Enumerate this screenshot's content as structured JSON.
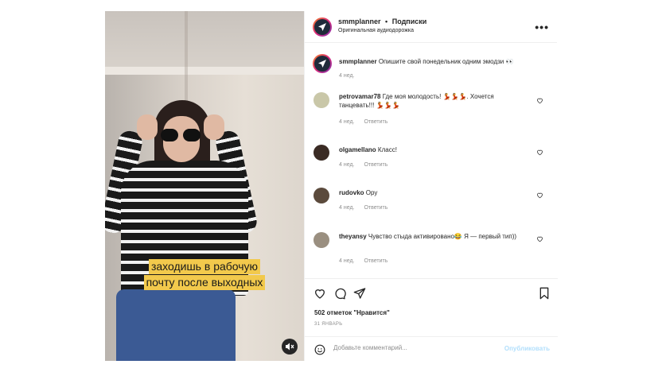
{
  "video": {
    "caption_line1": "заходишь в рабочую",
    "caption_line2": "почту после выходных",
    "mute_icon": "muted-speaker-icon"
  },
  "header": {
    "username": "smmplanner",
    "separator": "•",
    "follow_label": "Подписки",
    "audio_label": "Оригинальная аудиодорожка",
    "more_icon": "more-dots-icon"
  },
  "caption_post": {
    "username": "smmplanner",
    "text": "Опишите свой понедельник одним эмодзи 👀",
    "time": "4 нед."
  },
  "comments": [
    {
      "username": "petrovamar78",
      "text": "Где моя молодость! 💃💃💃. Хочется танцевать!!! 💃💃💃",
      "time": "4 нед.",
      "reply": "Ответить",
      "avatar_color": "#c9c7a8"
    },
    {
      "username": "olgamellano",
      "text": "Класс!",
      "time": "4 нед.",
      "reply": "Ответить",
      "avatar_color": "#3a2b24"
    },
    {
      "username": "rudovko",
      "text": "Ору",
      "time": "4 нед.",
      "reply": "Ответить",
      "avatar_color": "#5b4a3c"
    },
    {
      "username": "theyansy",
      "text": "Чувство стыда активировано😂 Я — первый тип))",
      "time": "4 нед.",
      "reply": "Ответить",
      "avatar_color": "#9a8f80"
    }
  ],
  "actions": {
    "likes": "502 отметок \"Нравится\"",
    "date": "31 ЯНВАРЬ"
  },
  "add_comment": {
    "placeholder": "Добавьте комментарий...",
    "publish_label": "Опубликовать"
  },
  "colors": {
    "accent_disabled": "#b2dffc",
    "caption_bg": "#f2c94c",
    "muted_text": "#8e8e8e"
  }
}
